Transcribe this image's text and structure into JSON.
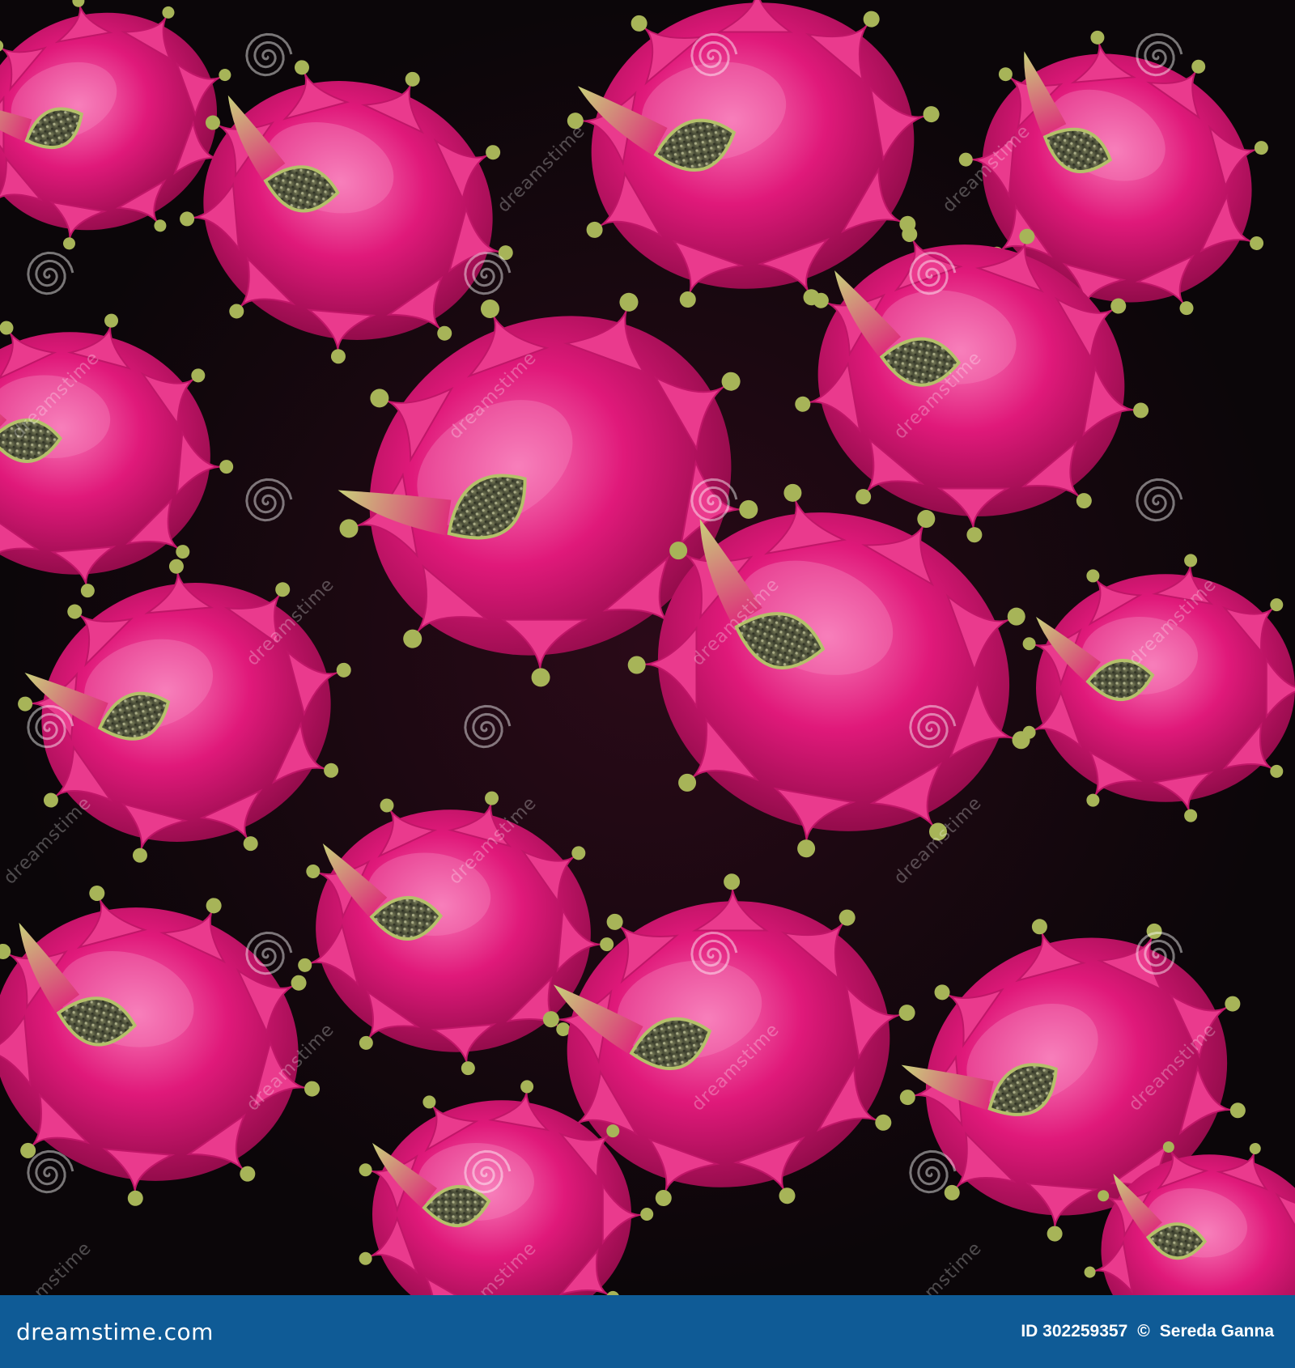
{
  "watermark": {
    "brand_text": "dreamstime",
    "footer_logo": "dreamstime.com",
    "image_id": "ID 302259357",
    "copyright_symbol": "©",
    "author": "Sereda Ganna",
    "icon": "spiral-watermark-icon"
  },
  "photo": {
    "subject": "",
    "colors": {
      "skin": "#e0197a",
      "skin_light": "#f05aa5",
      "skin_dark": "#9c0d4f",
      "scale_tip": "#9db24a",
      "seed_core": "#5f6448",
      "background": "#0b0609",
      "footer": "#0f5b96"
    }
  }
}
